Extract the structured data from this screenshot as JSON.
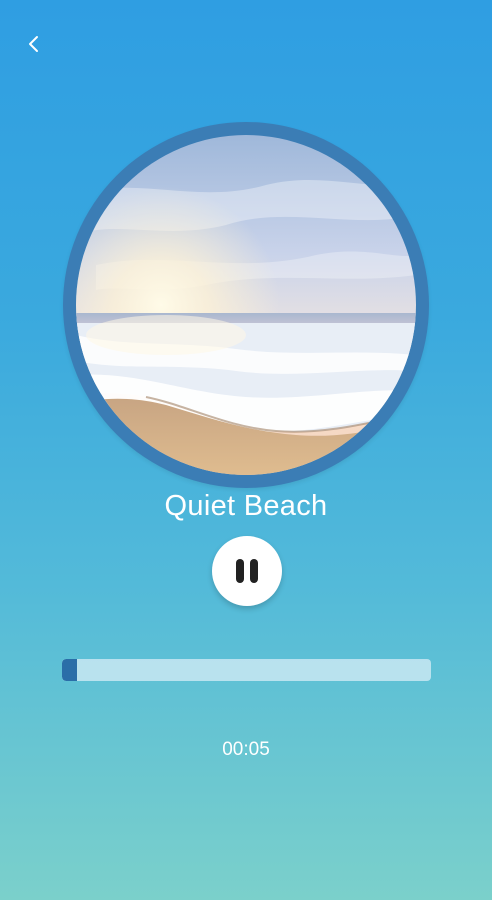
{
  "header": {
    "back_icon": "chevron-left-icon"
  },
  "player": {
    "artwork": "beach-sunrise-image",
    "track_title": "Quiet Beach",
    "play_state_icon": "pause-icon",
    "progress_fraction": 0.04,
    "elapsed_time": "00:05"
  },
  "colors": {
    "background_top": "#2f9ee2",
    "background_bottom": "#7bd0cb",
    "artwork_ring": "#3b7db5",
    "progress_fill": "#2a6ea8",
    "progress_track": "#cfe6f3",
    "text": "#ffffff"
  }
}
